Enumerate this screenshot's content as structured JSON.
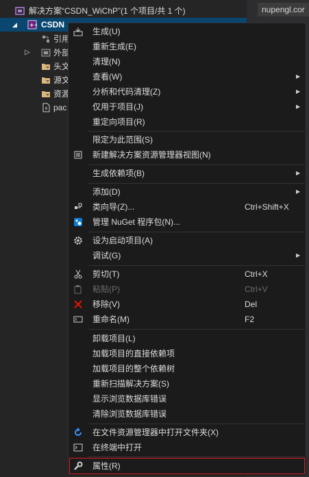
{
  "tree": {
    "solution": "解决方案“CSDN_WiChP”(1 个项目/共 1 个)",
    "project": "CSDN",
    "items": [
      "引用",
      "外部",
      "头文",
      "源文",
      "资源",
      "pac"
    ]
  },
  "right_tab": "nupengl.cor",
  "menu": {
    "items": [
      {
        "label": "生成(U)",
        "icon": "build-icon"
      },
      {
        "label": "重新生成(E)"
      },
      {
        "label": "清理(N)"
      },
      {
        "label": "查看(W)",
        "submenu": true
      },
      {
        "label": "分析和代码清理(Z)",
        "submenu": true
      },
      {
        "label": "仅用于项目(J)",
        "submenu": true
      },
      {
        "label": "重定向项目(R)"
      },
      {
        "label": "限定为此范围(S)"
      },
      {
        "label": "新建解决方案资源管理器视图(N)",
        "icon": "new-view-icon"
      },
      {
        "label": "生成依赖项(B)",
        "submenu": true
      },
      {
        "label": "添加(D)",
        "submenu": true
      },
      {
        "label": "类向导(Z)...",
        "shortcut": "Ctrl+Shift+X",
        "icon": "class-wizard-icon"
      },
      {
        "label": "管理 NuGet 程序包(N)...",
        "icon": "nuget-icon"
      },
      {
        "label": "设为启动项目(A)",
        "icon": "gear-icon"
      },
      {
        "label": "调试(G)",
        "submenu": true
      },
      {
        "label": "剪切(T)",
        "shortcut": "Ctrl+X",
        "icon": "scissors-icon"
      },
      {
        "label": "粘贴(P)",
        "shortcut": "Ctrl+V",
        "disabled": true,
        "icon": "paste-icon"
      },
      {
        "label": "移除(V)",
        "shortcut": "Del",
        "icon": "remove-icon"
      },
      {
        "label": "重命名(M)",
        "shortcut": "F2",
        "icon": "rename-icon"
      },
      {
        "label": "卸载项目(L)"
      },
      {
        "label": "加载项目的直接依赖项"
      },
      {
        "label": "加载项目的整个依赖树"
      },
      {
        "label": "重新扫描解决方案(S)"
      },
      {
        "label": "显示浏览数据库错误"
      },
      {
        "label": "清除浏览数据库错误"
      },
      {
        "label": "在文件资源管理器中打开文件夹(X)",
        "icon": "refresh-arrow-icon"
      },
      {
        "label": "在终端中打开",
        "icon": "terminal-icon"
      },
      {
        "label": "属性(R)",
        "icon": "wrench-icon"
      }
    ]
  },
  "colors": {
    "accent": "#094771",
    "highlight_border": "#e02020",
    "remove_red": "#e51400",
    "nuget_blue": "#0c7ccf"
  }
}
